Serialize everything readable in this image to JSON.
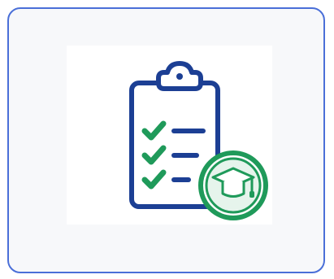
{
  "card": {
    "icon": "clipboard-checklist-graduation-cap-icon"
  },
  "colors": {
    "card_border": "#4a6fd8",
    "card_background": "#f7f8fa",
    "tile_background": "#ffffff",
    "clipboard_navy": "#1c3f94",
    "check_green": "#1f9a5a",
    "badge_green": "#1f9a5a",
    "badge_fill": "#e6f4ec"
  }
}
